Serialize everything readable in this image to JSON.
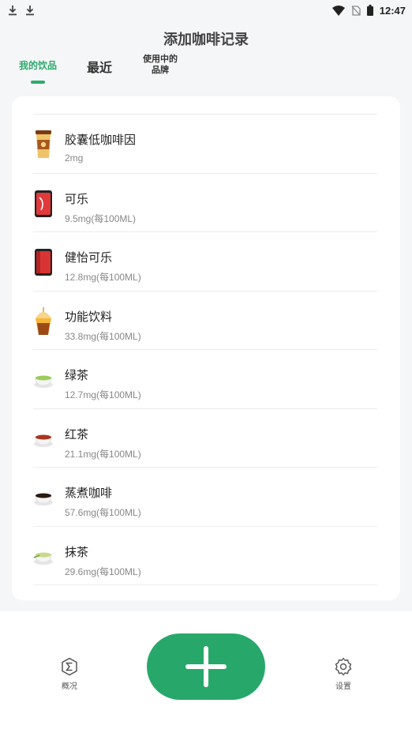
{
  "status_bar": {
    "time": "12:47",
    "icons": [
      "download-icon",
      "download-icon",
      "wifi-icon",
      "no-sim-icon",
      "battery-icon"
    ]
  },
  "header": {
    "title": "添加咖啡记录"
  },
  "tabs": [
    {
      "label": "我的饮品",
      "active": true
    },
    {
      "label": "最近",
      "active": false
    },
    {
      "label_line1": "使用中的",
      "label_line2": "品牌",
      "active": false
    }
  ],
  "drinks": [
    {
      "name": "胶囊低咖啡因",
      "amount": "2mg",
      "icon": "coffee-cup-icon"
    },
    {
      "name": "可乐",
      "amount": "9.5mg(每100ML)",
      "icon": "cola-can-icon"
    },
    {
      "name": "健怡可乐",
      "amount": "12.8mg(每100ML)",
      "icon": "diet-cola-can-icon"
    },
    {
      "name": "功能饮料",
      "amount": "33.8mg(每100ML)",
      "icon": "energy-drink-icon"
    },
    {
      "name": "绿茶",
      "amount": "12.7mg(每100ML)",
      "icon": "green-tea-icon"
    },
    {
      "name": "红茶",
      "amount": "21.1mg(每100ML)",
      "icon": "black-tea-icon"
    },
    {
      "name": "蒸煮咖啡",
      "amount": "57.6mg(每100ML)",
      "icon": "brewed-coffee-icon"
    },
    {
      "name": "抹茶",
      "amount": "29.6mg(每100ML)",
      "icon": "matcha-icon"
    }
  ],
  "bottom_nav": {
    "overview_label": "概况",
    "settings_label": "设置",
    "add_icon": "plus-icon"
  },
  "colors": {
    "accent": "#27a86a",
    "background": "#f5f6f8"
  }
}
